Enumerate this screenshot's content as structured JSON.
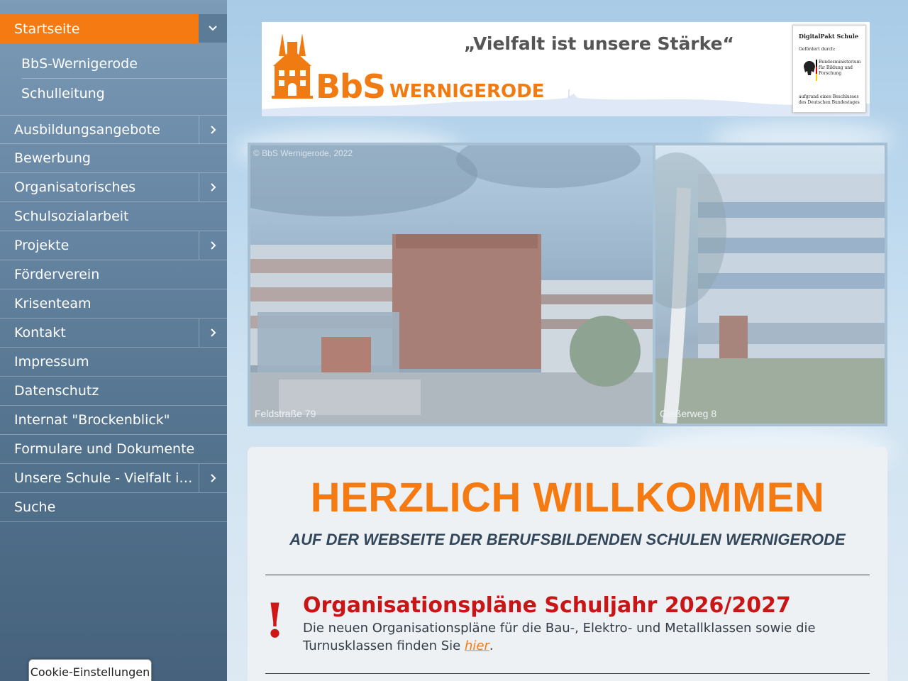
{
  "sidebar": {
    "active": {
      "label": "Startseite"
    },
    "subitems": [
      {
        "label": "BbS-Wernigerode"
      },
      {
        "label": "Schulleitung"
      }
    ],
    "items": [
      {
        "label": "Ausbildungsangebote",
        "expandable": true
      },
      {
        "label": "Bewerbung",
        "expandable": false
      },
      {
        "label": "Organisatorisches",
        "expandable": true
      },
      {
        "label": "Schulsozialarbeit",
        "expandable": false
      },
      {
        "label": "Projekte",
        "expandable": true
      },
      {
        "label": "Förderverein",
        "expandable": false
      },
      {
        "label": "Krisenteam",
        "expandable": false
      },
      {
        "label": "Kontakt",
        "expandable": true
      },
      {
        "label": "Impressum",
        "expandable": false
      },
      {
        "label": "Datenschutz",
        "expandable": false
      },
      {
        "label": "Internat \"Brockenblick\"",
        "expandable": false
      },
      {
        "label": "Formulare und Dokumente",
        "expandable": false
      },
      {
        "label": "Unsere Schule - Vielfalt im ...",
        "expandable": true
      },
      {
        "label": "Suche",
        "expandable": false
      }
    ]
  },
  "banner": {
    "slogan": "„Vielfalt ist unsere Stärke“",
    "logo_bbs": "BbS",
    "logo_wernigerode": "WERNIGERODE",
    "digitalpakt": {
      "title": "DigitalPakt Schule",
      "sponsored": "Gefördert durch:",
      "ministry": "Bundesministerium für Bildung und Forschung",
      "footnote": "aufgrund eines Beschlusses des Deutschen Bundestages"
    }
  },
  "photos": {
    "copyright": "© BbS Wernigerode, 2022",
    "left_caption": "Feldstraße 79",
    "right_caption": "Gießerweg 8"
  },
  "content": {
    "title": "HERZLICH WILLKOMMEN",
    "subtitle": "AUF DER WEBSEITE DER BERUFSBILDENDEN SCHULEN WERNIGERODE",
    "news": {
      "title": "Organisationspläne Schuljahr 2026/2027",
      "text_before": "Die neuen Organisationspläne für die Bau-, Elektro- und   Metallklassen sowie die Turnusklassen finden Sie ",
      "link": "hier",
      "text_after": "."
    }
  },
  "cookie": {
    "label": "Cookie-Einstellungen"
  },
  "colors": {
    "accent": "#f47a11",
    "news_red": "#c91516",
    "sidebar": "#5c7b97"
  }
}
